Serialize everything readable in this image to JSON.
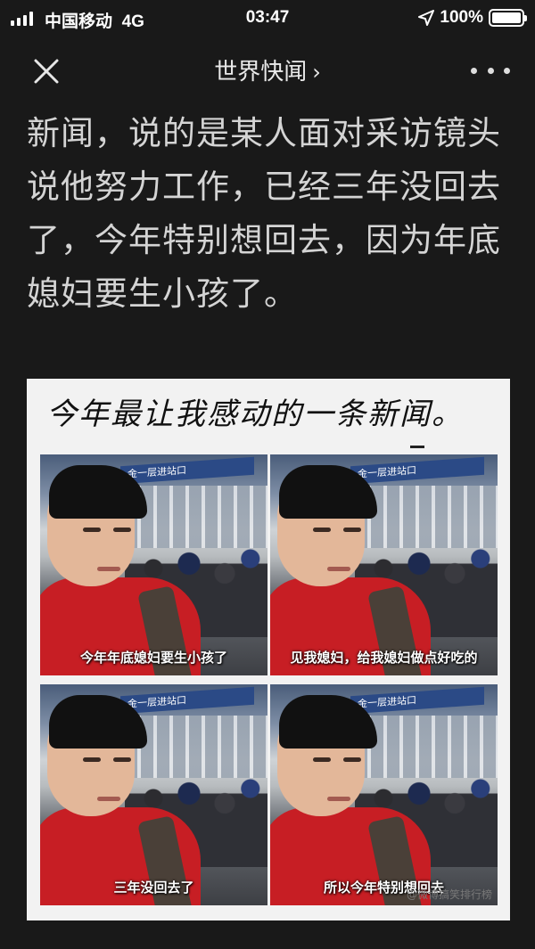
{
  "status_bar": {
    "carrier": "中国移动",
    "network": "4G",
    "time": "03:47",
    "battery": "100%"
  },
  "nav": {
    "title": "世界快闻",
    "chevron": "›",
    "close_icon": "close-icon",
    "more_icon": "more-icon"
  },
  "article": {
    "text": "新闻，说的是某人面对采访镜头说他努力工作，已经三年没回去了，今年特别想回去，因为年底媳妇要生小孩了。"
  },
  "image": {
    "handwritten_title": "今年最让我感动的一条新闻。",
    "sign_text": "金一层进站口",
    "captions": [
      "今年年底媳妇要生小孩了",
      "见我媳妇，给我媳妇做点好吃的",
      "三年没回去了",
      "所以今年特别想回去"
    ],
    "watermark": "@微博搞笑排行榜"
  },
  "colors": {
    "background": "#191919",
    "article_text": "#d4d4d4",
    "jacket_red": "#c71e24",
    "sign_blue": "#2b4a86"
  }
}
